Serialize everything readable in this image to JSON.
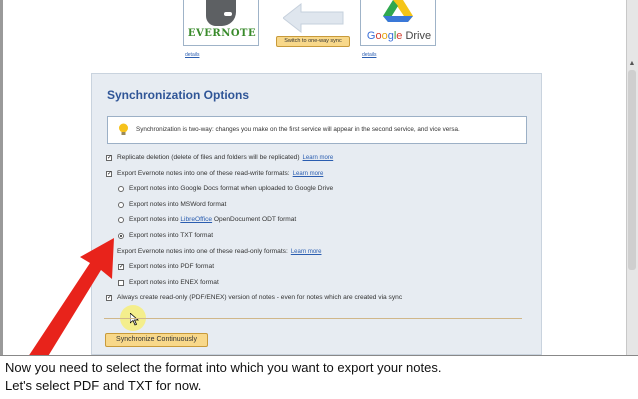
{
  "header": {
    "evernote_label": "EVERNOTE",
    "gdrive_label": {
      "g1": "G",
      "o1": "o",
      "o2": "o",
      "g2": "g",
      "l": "l",
      "e": "e",
      "drive": " Drive"
    },
    "details_left": "details",
    "details_right": "details",
    "switch_button": "Switch to one-way sync"
  },
  "panel": {
    "title": "Synchronization Options",
    "info": "Synchronization is two-way: changes you make on the first service will appear in the second service, and vice versa.",
    "learn_more": "Learn more",
    "options": {
      "replicate": "Replicate deletion (delete of files and folders will be replicated)",
      "export_rw": "Export Evernote notes into one of these read-write formats:",
      "gdocs": "Export notes into Google Docs format when uploaded to Google Drive",
      "msword": "Export notes into MSWord format",
      "odt_pre": "Export notes into ",
      "odt_link": "LibreOffice",
      "odt_post": " OpenDocument ODT format",
      "txt": "Export notes into TXT format",
      "export_ro": "Export Evernote notes into one of these read-only formats:",
      "pdf": "Export notes into PDF format",
      "enex": "Export notes into ENEX format",
      "always_ro": "Always create read-only (PDF/ENEX) version of notes - even for notes which are created via sync"
    },
    "checked": {
      "replicate": true,
      "export_rw": true,
      "txt_selected": true,
      "export_ro": false,
      "pdf": true,
      "enex": false,
      "always_ro": true
    },
    "sync_button": "Synchronize Continuously"
  },
  "caption": {
    "line1": "Now you need to select the format into which you want to export your notes.",
    "line2": "Let's select PDF and TXT for now."
  },
  "colors": {
    "panel_title": "#2f5597",
    "button_fill": "#f8d88a",
    "arrow_red": "#e8231b"
  }
}
